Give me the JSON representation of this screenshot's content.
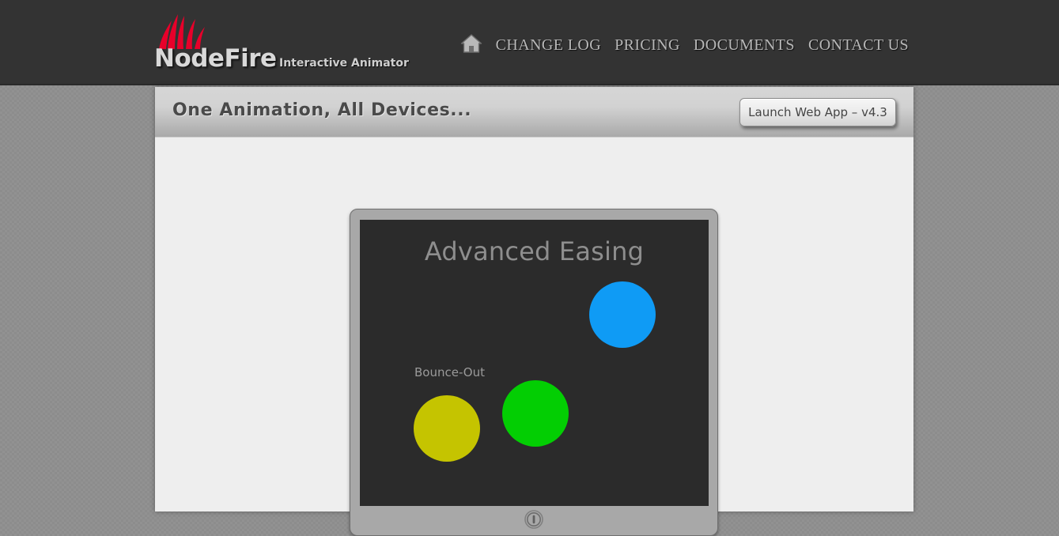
{
  "header": {
    "logo_icon": "flame-logo",
    "brand_name": "NodeFire",
    "tagline": "Interactive Animator",
    "nav": {
      "home_icon": "home-icon",
      "items": [
        {
          "label": "CHANGE LOG"
        },
        {
          "label": "PRICING"
        },
        {
          "label": "DOCUMENTS"
        },
        {
          "label": "CONTACT US"
        }
      ]
    },
    "background_color": "#333333",
    "logo_accent_color": "#e8002a"
  },
  "subheader": {
    "title": "One Animation, All Devices...",
    "launch_button_label": "Launch Web App – v4.3"
  },
  "device": {
    "frame_color": "#a8a8a8",
    "screen_color": "#2b2b2b",
    "home_button_icon": "power-button-icon",
    "screen": {
      "title": "Advanced Easing",
      "title_color": "#8e8e8e",
      "easing_label": "Bounce-Out",
      "easing_label_color": "#9a9a9a",
      "balls": [
        {
          "name": "blue-ball",
          "color": "#0f9bf5"
        },
        {
          "name": "green-ball",
          "color": "#03ce03"
        },
        {
          "name": "yellow-ball",
          "color": "#c5c400"
        }
      ]
    }
  },
  "page": {
    "background_color": "#8c8c8c",
    "panel_background_color": "#eeeeee"
  }
}
